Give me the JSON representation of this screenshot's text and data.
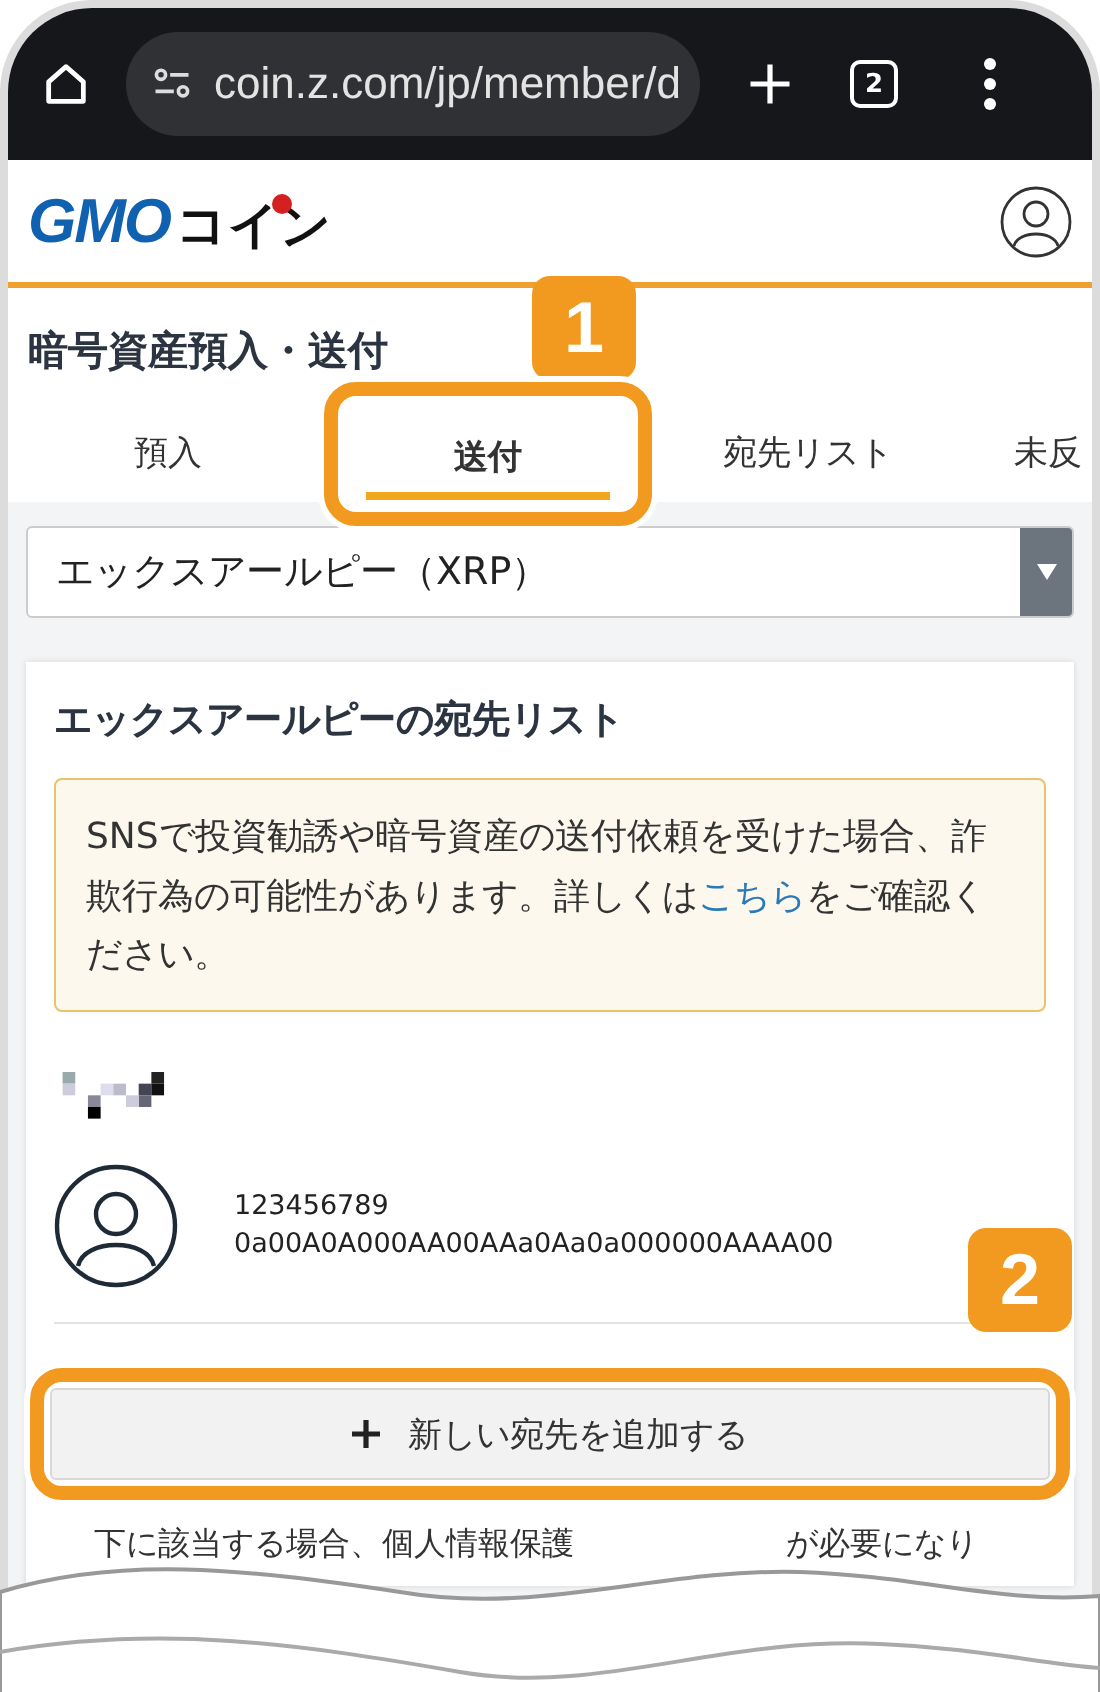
{
  "browser": {
    "url": "coin.z.com/jp/member/d",
    "tab_count": "2"
  },
  "header": {
    "logo_brand": "GMO",
    "logo_name": "コイン"
  },
  "page_title": "暗号資産預入・送付",
  "tabs": [
    {
      "label": "預入",
      "selected": false
    },
    {
      "label": "送付",
      "selected": true
    },
    {
      "label": "宛先リスト",
      "selected": false
    },
    {
      "label": "未反",
      "selected": false
    }
  ],
  "currency_select": {
    "value": "エックスアールピー（XRP）"
  },
  "card": {
    "title": "エックスアールピーの宛先リスト",
    "warning": {
      "before": "SNSで投資勧誘や暗号資産の送付依頼を受けた場合、詐欺行為の可能性があります。詳しくは",
      "link": "こちら",
      "after": "をご確認ください。"
    },
    "entries": [
      {
        "account": "123456789",
        "address": "0a00A0A000AA00AAa0Aa0a000000AAAA00"
      }
    ],
    "add_button": "新しい宛先を追加する"
  },
  "footer_fragments": [
    "下に該当する場合、個人情報保護",
    "が必要になり"
  ],
  "callouts": [
    {
      "label": "1",
      "kind": "tab"
    },
    {
      "label": "2",
      "kind": "button"
    }
  ]
}
